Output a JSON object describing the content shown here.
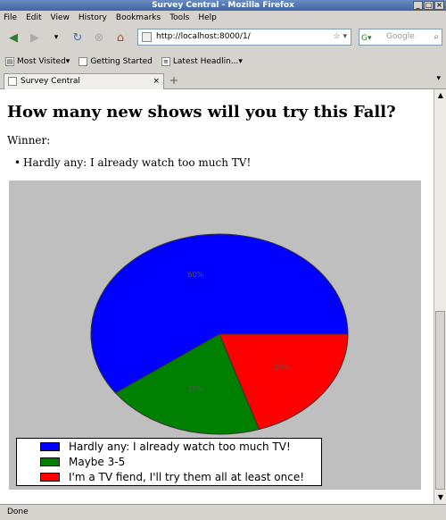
{
  "window": {
    "title": "Survey Central - Mozilla Firefox"
  },
  "menu": [
    "File",
    "Edit",
    "View",
    "History",
    "Bookmarks",
    "Tools",
    "Help"
  ],
  "nav": {
    "url": "http://localhost:8000/1/",
    "search_placeholder": "Google"
  },
  "bookmarks": [
    "Most Visited",
    "Getting Started",
    "Latest Headlin..."
  ],
  "tab": {
    "label": "Survey Central"
  },
  "page": {
    "heading": "How many new shows will you try this Fall?",
    "winner_label": "Winner:",
    "winner": "Hardly any: I already watch too much TV!"
  },
  "chart_data": {
    "type": "pie",
    "categories": [
      "Hardly any: I already watch too much TV!",
      "Maybe 3-5",
      "I'm a TV fiend, I'll try them all at least once!"
    ],
    "values": [
      60,
      20,
      20
    ],
    "labels": [
      "60%",
      "20%",
      "20%"
    ],
    "colors": [
      "#0000ff",
      "#008000",
      "#ff0000"
    ],
    "legend": "bottom-left"
  },
  "status": {
    "text": "Done"
  }
}
